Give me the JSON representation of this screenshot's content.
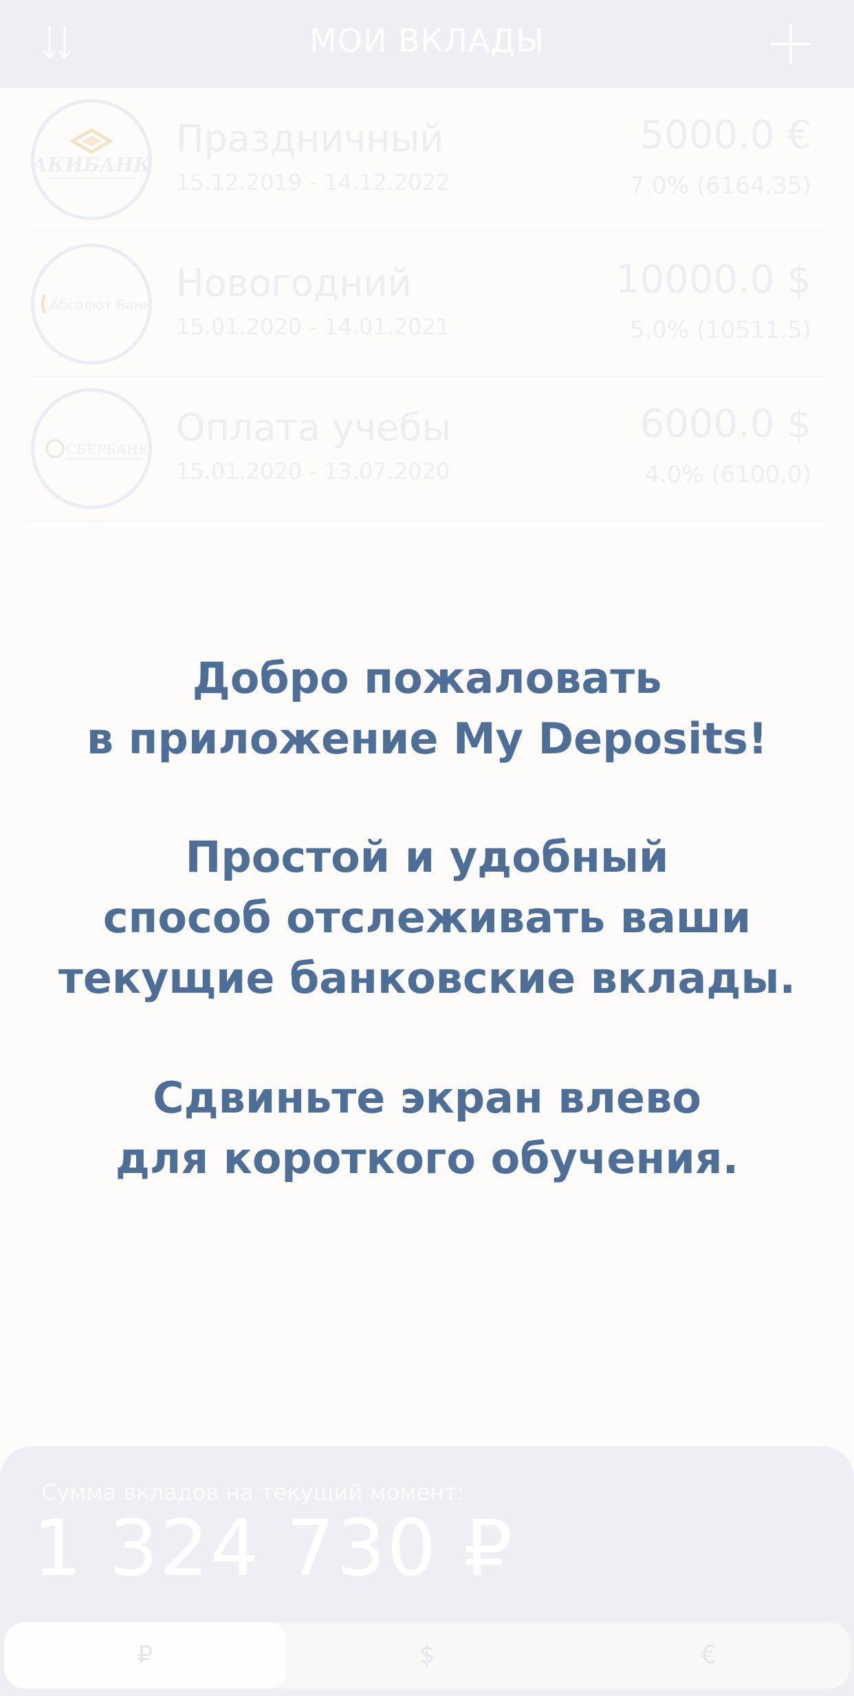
{
  "header": {
    "title": "МОИ ВКЛАДЫ",
    "sort_icon": "sort-arrows-icon",
    "add_icon": "plus-icon"
  },
  "deposits": [
    {
      "bank": "АКИБАНК",
      "name": "Праздничный",
      "dates": "15.12.2019 - 14.12.2022",
      "amount": "5000.0 €",
      "rate": "7.0% (6164.35)"
    },
    {
      "bank": "Абсолют Банк",
      "name": "Новогодний",
      "dates": "15.01.2020 - 14.01.2021",
      "amount": "10000.0 $",
      "rate": "5.0% (10511.5)"
    },
    {
      "bank": "СБЕРБАНК",
      "name": "Оплата учебы",
      "dates": "15.01.2020 - 13.07.2020",
      "amount": "6000.0 $",
      "rate": "4.0% (6100.0)"
    }
  ],
  "welcome": {
    "line1": "Добро пожаловать",
    "line2": "в приложение My Deposits!",
    "line3": "Простой и удобный",
    "line4": "способ отслеживать ваши",
    "line5": "текущие банковские вклады.",
    "line6": "Сдвиньте экран влево",
    "line7": "для короткого обучения."
  },
  "footer": {
    "caption": "Сумма вкладов на текущий момент:",
    "total": "1 324 730 ₽",
    "tabs": [
      "₽",
      "$",
      "€"
    ],
    "active_tab": "₽"
  },
  "colors": {
    "header_bg": "#eeeef4",
    "welcome_text": "#4d6e96",
    "page_bg": "#fdfcfb"
  }
}
